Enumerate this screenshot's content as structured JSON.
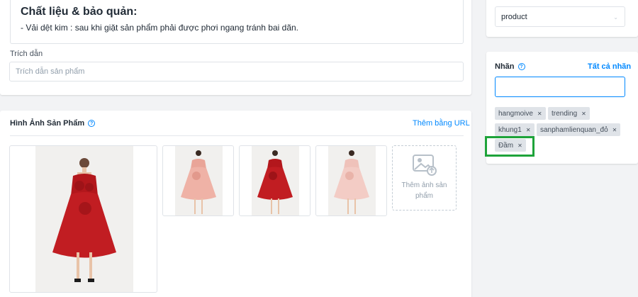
{
  "description": {
    "heading": "Chất liệu & bảo quản:",
    "text": "- Vải dệt kim : sau khi giặt sản phẩm phải được phơi ngang tránh bai dãn.",
    "excerpt_label": "Trích dẫn",
    "excerpt_placeholder": "Trích dẫn sản phẩm"
  },
  "images": {
    "title": "Hình Ảnh Sản Phẩm",
    "add_by_url": "Thêm bằng URL",
    "add_image_label": "Thêm ảnh sản phẩm",
    "items": [
      {
        "name": "red-ruffle-dress-main",
        "dress_color": "#b3171c"
      },
      {
        "name": "pink-ruffle-dress",
        "dress_color": "#e9a598"
      },
      {
        "name": "red-ruffle-dress",
        "dress_color": "#b3171c"
      },
      {
        "name": "light-pink-dress",
        "dress_color": "#efc2ba"
      }
    ]
  },
  "product_type": {
    "value": "product"
  },
  "tags": {
    "title": "Nhãn",
    "all_tags_link": "Tất cả nhãn",
    "input_value": "",
    "items": [
      "hangmoive",
      "trending",
      "khung1",
      "sanphamlienquan_đỏ",
      "Đầm"
    ],
    "highlighted_tag": "Đầm"
  },
  "colors": {
    "accent": "#0088ff",
    "highlight": "#1ea33a",
    "tag_bg": "#dfe3e8"
  }
}
